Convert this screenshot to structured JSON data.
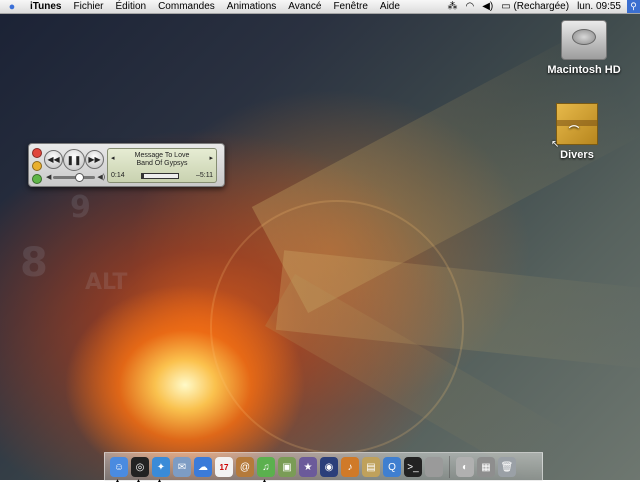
{
  "menubar": {
    "apple_icon": "apple-logo",
    "app_name": "iTunes",
    "items": [
      "Fichier",
      "Édition",
      "Commandes",
      "Animations",
      "Avancé",
      "Fenêtre",
      "Aide"
    ],
    "status": {
      "icons": [
        "extra-icon",
        "wifi-icon",
        "volume-icon",
        "battery-icon"
      ],
      "battery_text": "(Rechargée)",
      "clock": "lun. 09:55",
      "spotlight_icon": "search-icon"
    }
  },
  "desktop": {
    "icons": [
      {
        "label": "Macintosh HD",
        "icon": "hard-drive-icon"
      },
      {
        "label": "Divers",
        "icon": "box-folder-icon"
      }
    ]
  },
  "miniplayer": {
    "track": "Message To Love",
    "artist": "Band Of Gypsys",
    "elapsed": "0:14",
    "remaining": "–5:11",
    "progress": 0.04,
    "volume": 0.6,
    "controls": [
      "previous-icon",
      "pause-icon",
      "next-icon"
    ]
  },
  "dock": {
    "items": [
      {
        "name": "finder",
        "icon": "finder-icon",
        "color": "#4a8be0",
        "glyph": "☺",
        "running": true
      },
      {
        "name": "dashboard",
        "icon": "dashboard-icon",
        "color": "#222222",
        "glyph": "◎",
        "running": true
      },
      {
        "name": "safari",
        "icon": "safari-icon",
        "color": "#3a8bd8",
        "glyph": "✦",
        "running": true
      },
      {
        "name": "mail",
        "icon": "mail-icon",
        "color": "#7d9cc4",
        "glyph": "✉",
        "running": false
      },
      {
        "name": "ichat",
        "icon": "ichat-icon",
        "color": "#3b7bd9",
        "glyph": "☁",
        "running": false
      },
      {
        "name": "ical",
        "icon": "calendar-icon",
        "color": "#f2f2f2",
        "glyph": "17",
        "running": false
      },
      {
        "name": "address-book",
        "icon": "address-book-icon",
        "color": "#b57a3a",
        "glyph": "@",
        "running": false
      },
      {
        "name": "itunes",
        "icon": "itunes-icon",
        "color": "#5bb04e",
        "glyph": "♫",
        "running": true
      },
      {
        "name": "iphoto",
        "icon": "iphoto-icon",
        "color": "#7a9c56",
        "glyph": "▣",
        "running": false
      },
      {
        "name": "imovie",
        "icon": "imovie-icon",
        "color": "#6b5a9a",
        "glyph": "★",
        "running": false
      },
      {
        "name": "idvd",
        "icon": "idvd-icon",
        "color": "#2b3f7a",
        "glyph": "◉",
        "running": false
      },
      {
        "name": "garageband",
        "icon": "garageband-icon",
        "color": "#d07a28",
        "glyph": "♪",
        "running": false
      },
      {
        "name": "preview",
        "icon": "preview-icon",
        "color": "#bfa15c",
        "glyph": "▤",
        "running": false
      },
      {
        "name": "quicktime",
        "icon": "quicktime-icon",
        "color": "#3f7fd0",
        "glyph": "Q",
        "running": false
      },
      {
        "name": "terminal",
        "icon": "terminal-icon",
        "color": "#222222",
        "glyph": ">_",
        "running": false
      },
      {
        "name": "system-prefs",
        "icon": "system-preferences-icon",
        "color": "#9a9a9a",
        "glyph": "",
        "running": false
      }
    ],
    "right_items": [
      {
        "name": "documents-stack",
        "icon": "disk-utility-icon",
        "color": "#b0b0b0",
        "glyph": "◐"
      },
      {
        "name": "network",
        "icon": "network-icon",
        "color": "#8e8e8e",
        "glyph": "▦"
      },
      {
        "name": "trash",
        "icon": "trash-icon",
        "color": "#9aa0a6",
        "glyph": "🗑"
      }
    ]
  }
}
